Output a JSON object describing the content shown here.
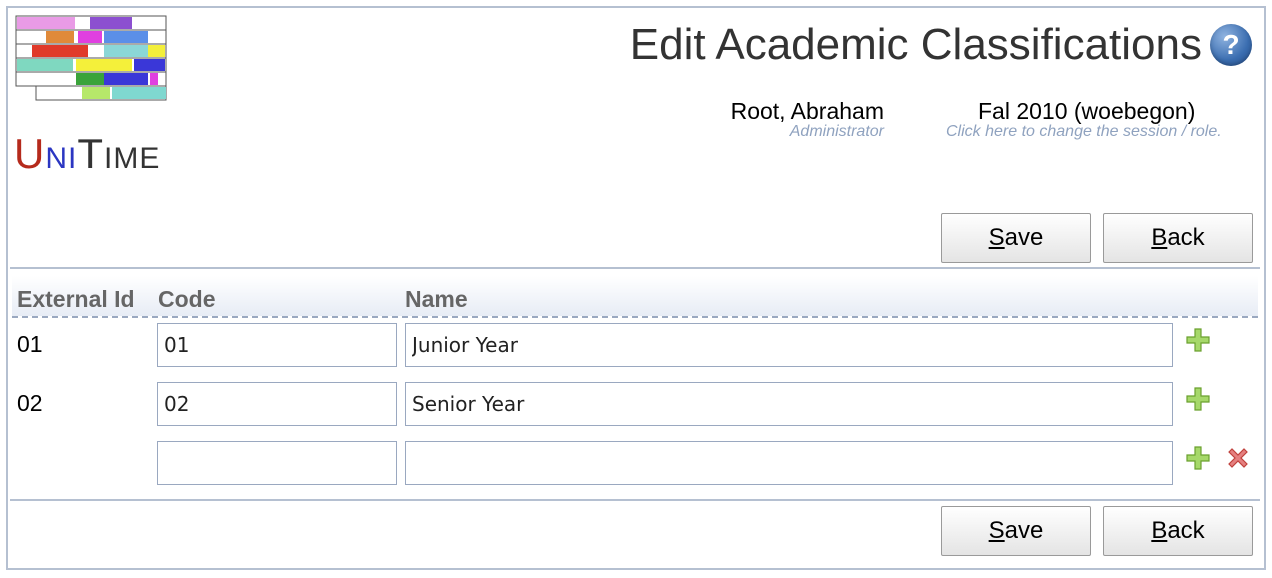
{
  "logo": {
    "text_parts": [
      "U",
      "NI",
      "T",
      "IME"
    ]
  },
  "header": {
    "title": "Edit Academic Classifications",
    "help_icon": "question-mark-icon",
    "user_name": "Root, Abraham",
    "user_role": "Administrator",
    "session_name": "Fal 2010 (woebegon)",
    "session_hint": "Click here to change the session / role."
  },
  "buttons": {
    "save_prefix": "S",
    "save_rest": "ave",
    "back_prefix": "B",
    "back_rest": "ack"
  },
  "table": {
    "columns": [
      "External Id",
      "Code",
      "Name"
    ],
    "rows": [
      {
        "external_id": "01",
        "code": "01",
        "name": "Junior Year"
      },
      {
        "external_id": "02",
        "code": "02",
        "name": "Senior Year"
      },
      {
        "external_id": "",
        "code": "",
        "name": ""
      }
    ],
    "add_icon": "plus-icon",
    "delete_icon": "delete-x-icon"
  },
  "colors": {
    "frame_border": "#b5c0d1",
    "add_icon": "#8dc63f",
    "delete_icon": "#d9534f"
  }
}
